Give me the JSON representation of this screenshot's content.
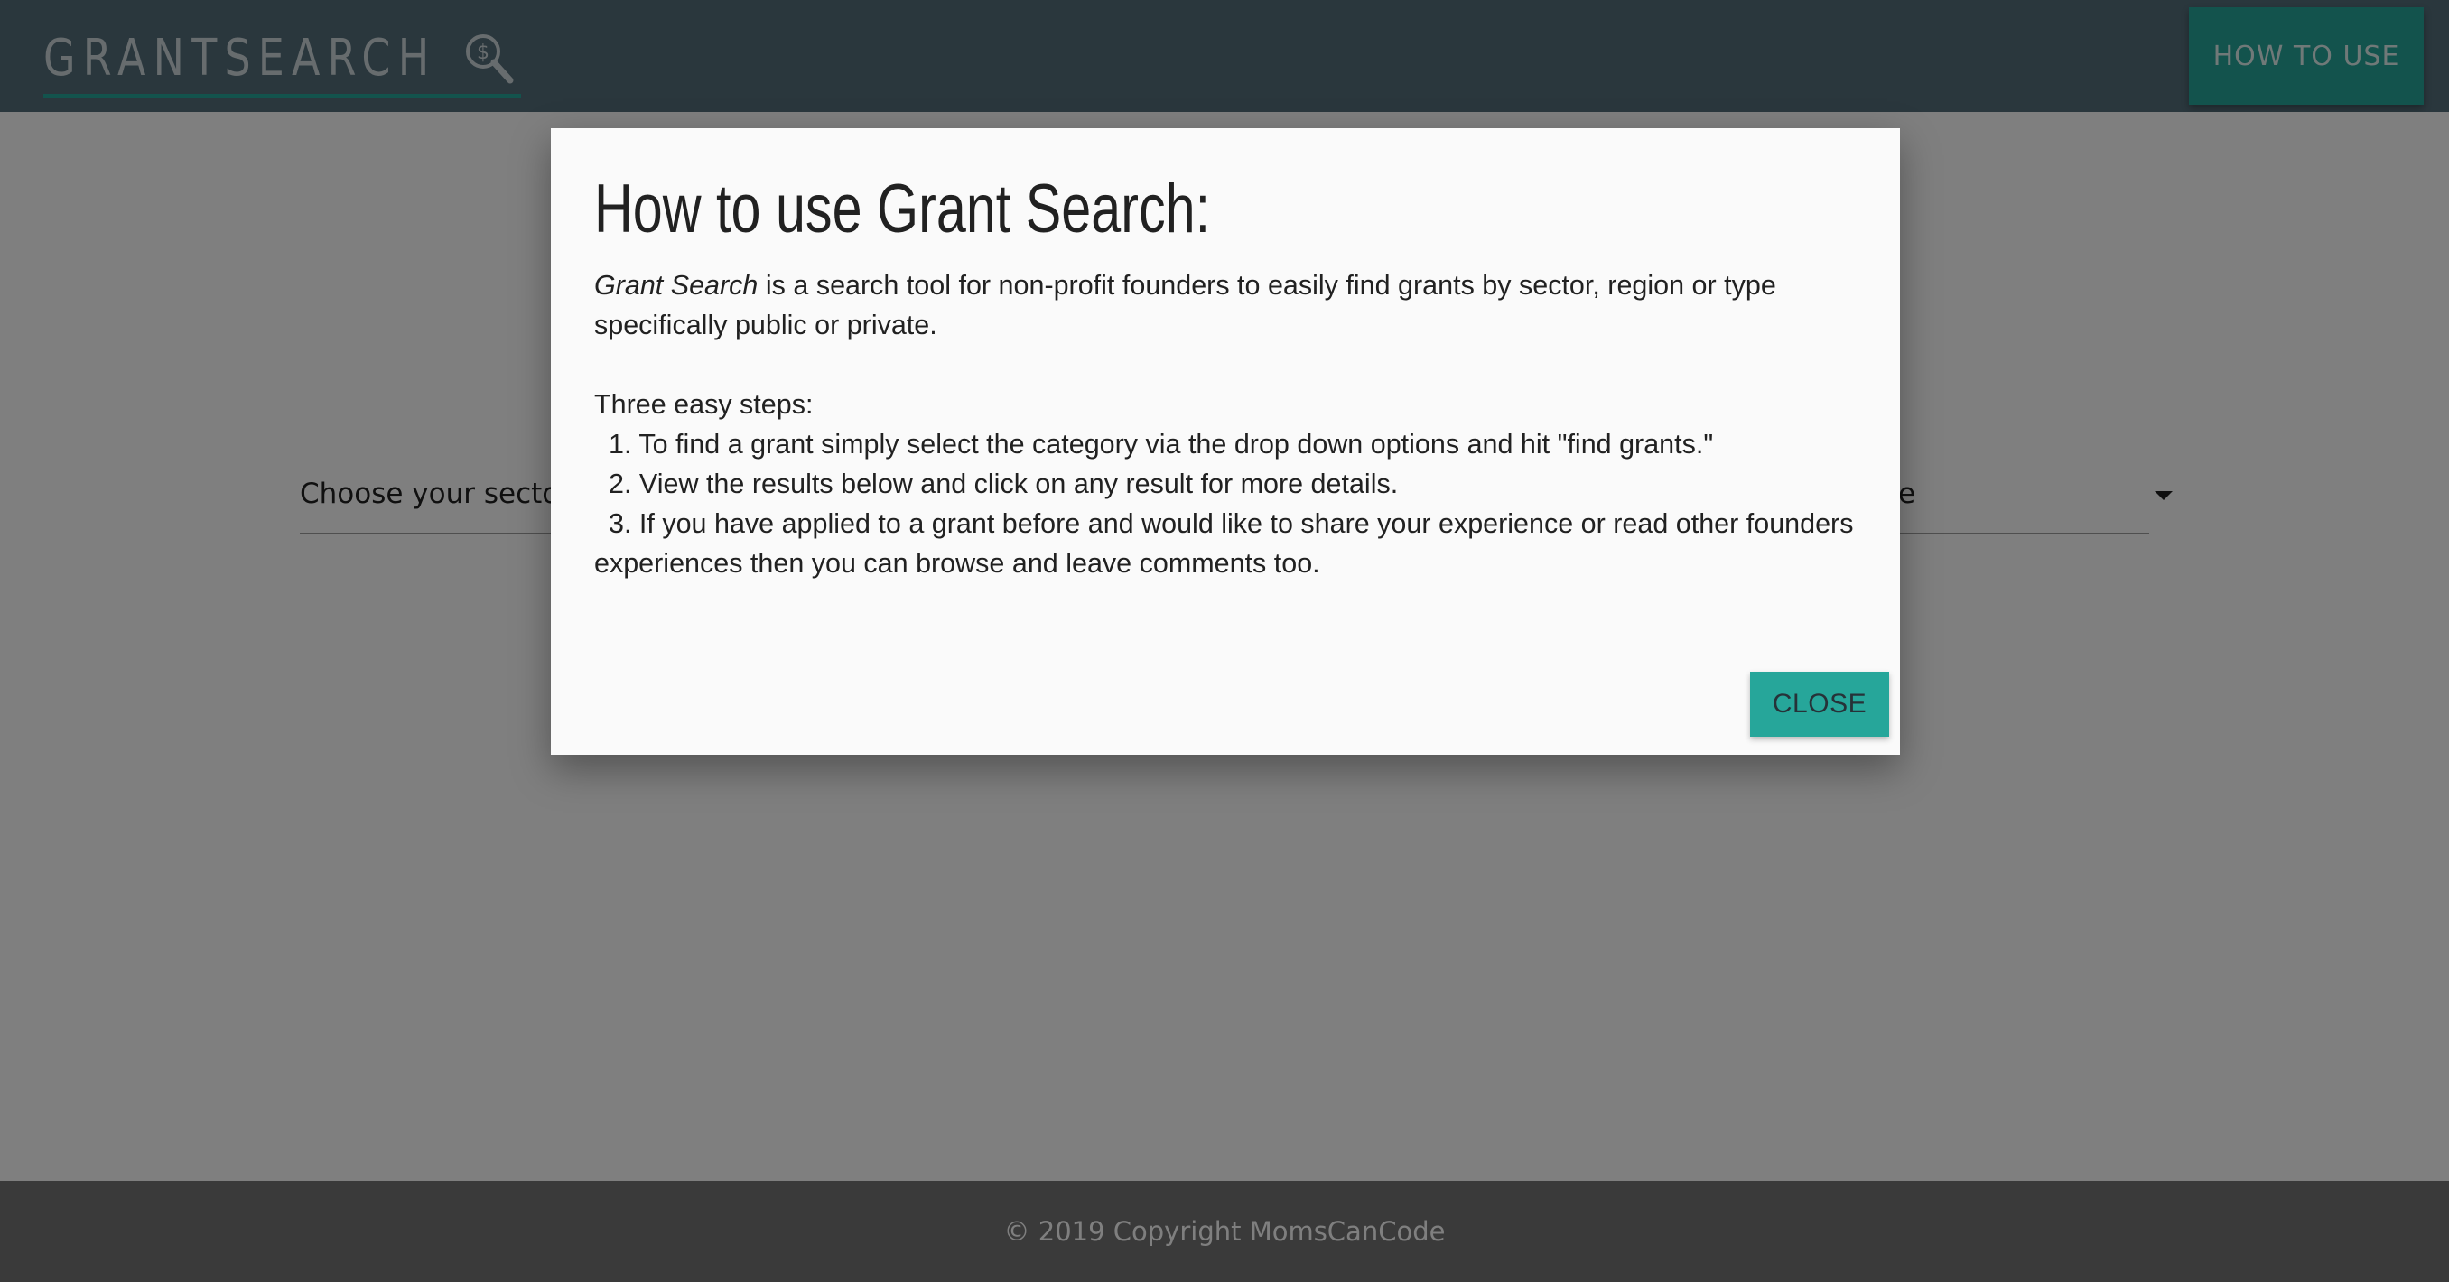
{
  "navbar": {
    "logo_text": "GRANTSEARCH",
    "logo_icon": "magnifier-dollar-icon",
    "how_to_label": "HOW TO USE"
  },
  "main": {
    "sector_select_text": "Choose your sector",
    "right_select_text": "e"
  },
  "modal": {
    "title": "How to use Grant Search:",
    "intro_emphasis": "Grant Search",
    "intro_rest": " is a search tool for non-profit founders to easily find grants by sector, region or type",
    "intro_line2": "specifically public or private.",
    "steps_title": "Three easy steps:",
    "step1": "1. To find a grant simply select the category via the drop down options and hit \"find grants.\"",
    "step2": "2. View the results below and click on any result for more details.",
    "step3": "3. If you have applied to a grant before and would like to share your experience or read other  founders",
    "step3_cont": "experiences then you can browse and leave comments too.",
    "close_label": "CLOSE"
  },
  "footer": {
    "copyright": "© 2019 Copyright MomsCanCode"
  },
  "colors": {
    "navbar": "#546e7a",
    "accent": "#26a69a",
    "footer": "#757575",
    "modal_bg": "#fafafa"
  }
}
